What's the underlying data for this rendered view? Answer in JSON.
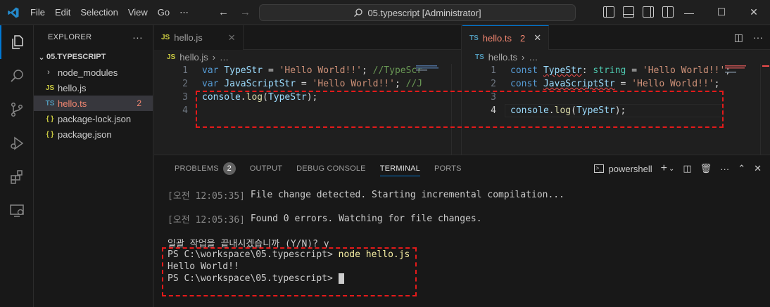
{
  "titlebar": {
    "menu": [
      "File",
      "Edit",
      "Selection",
      "View",
      "Go",
      "⋯"
    ],
    "search_text": "05.typescript [Administrator]"
  },
  "sidebar": {
    "header": "EXPLORER",
    "folder": "05.TYPESCRIPT",
    "items": [
      {
        "label": "node_modules",
        "type": "folder"
      },
      {
        "label": "hello.js",
        "type": "js",
        "icon": "JS"
      },
      {
        "label": "hello.ts",
        "type": "ts",
        "icon": "TS",
        "badge": "2"
      },
      {
        "label": "package-lock.json",
        "type": "json",
        "icon": "{ }"
      },
      {
        "label": "package.json",
        "type": "json",
        "icon": "{ }"
      }
    ]
  },
  "editor_left": {
    "tab_label": "hello.js",
    "tab_icon": "JS",
    "breadcrumb_file": "hello.js",
    "breadcrumb_more": "…",
    "line_numbers": [
      "1",
      "2",
      "3",
      "4"
    ]
  },
  "editor_right": {
    "tab_label": "hello.ts",
    "tab_icon": "TS",
    "tab_badge": "2",
    "breadcrumb_file": "hello.ts",
    "breadcrumb_more": "…",
    "line_numbers": [
      "1",
      "2",
      "3",
      "4"
    ]
  },
  "panel": {
    "tabs": [
      "PROBLEMS",
      "OUTPUT",
      "DEBUG CONSOLE",
      "TERMINAL",
      "PORTS"
    ],
    "problems_count": "2",
    "active_tab": "TERMINAL",
    "shell": "powershell",
    "terminal_lines": [
      "[오전 12:05:35] File change detected. Starting incremental compilation...",
      "",
      "[오전 12:05:36] Found 0 errors. Watching for file changes.",
      "",
      "일괄 작업을 끝내시겠습니까 (Y/N)? y",
      "PS C:\\workspace\\05.typescript> node hello.js",
      "Hello World!!",
      "PS C:\\workspace\\05.typescript> "
    ],
    "line1_time_prefix": "[오전 12:05:35]",
    "line1_rest": " File change detected. Starting incremental compilation...",
    "line2_time_prefix": "[오전 12:05:36]",
    "line2_rest": " Found 0 errors. Watching for file changes.",
    "line3": "일괄 작업을 끝내시겠습니까 (Y/N)? y",
    "prompt": "PS C:\\workspace\\05.typescript> ",
    "command": "node hello.js",
    "output": "Hello World!!"
  },
  "colors": {
    "accent": "#0078d4",
    "annotation_red": "#e41a1a",
    "error": "#f48771"
  }
}
